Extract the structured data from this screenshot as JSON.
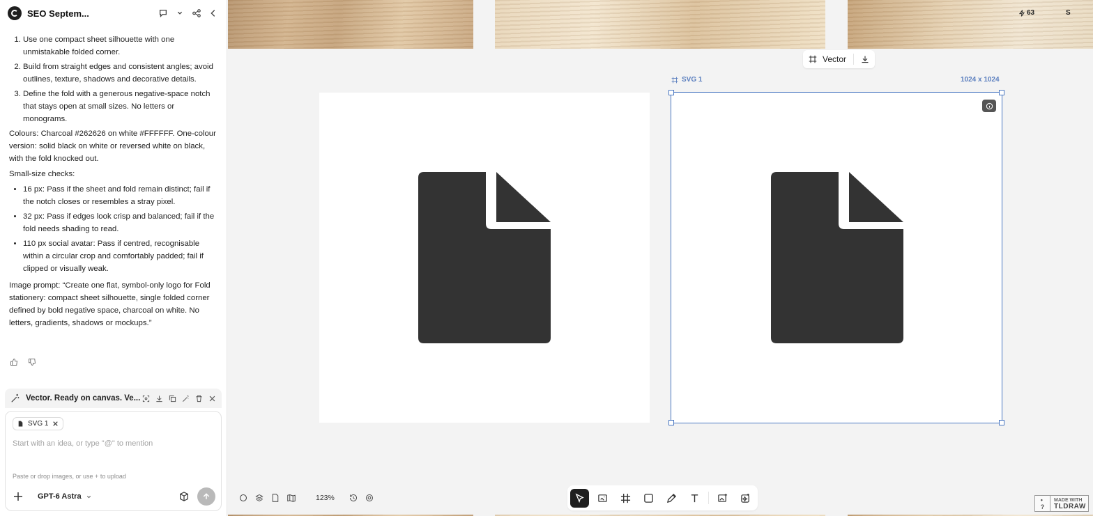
{
  "sidebar": {
    "title": "SEO Septem...",
    "message": {
      "steps": [
        "Use one compact sheet silhouette with one unmistakable folded corner.",
        "Build from straight edges and consistent angles; avoid outlines, texture, shadows and decorative details.",
        "Define the fold with a generous negative-space notch that stays open at small sizes. No letters or monograms."
      ],
      "colours": "Colours: Charcoal #262626 on white #FFFFFF. One-colour version: solid black on white or reversed white on black, with the fold knocked out.",
      "checks_heading": "Small-size checks:",
      "checks": [
        "16 px: Pass if the sheet and fold remain distinct; fail if the notch closes or resembles a stray pixel.",
        "32 px: Pass if edges look crisp and balanced; fail if the fold needs shading to read.",
        "110 px social avatar: Pass if centred, recognisable within a circular crop and comfortably padded; fail if clipped or visually weak."
      ],
      "image_prompt": "Image prompt: “Create one flat, symbol-only logo for Fold stationery: compact sheet silhouette, single folded corner defined by bold negative space, charcoal on white. No letters, gradients, shadows or mockups.”"
    },
    "status": "Vector. Ready on canvas. Ve...",
    "composer": {
      "chip": "SVG 1",
      "placeholder": "Start with an idea, or type \"@\" to mention",
      "hint": "Paste or drop images, or use + to upload",
      "model": "GPT-6 Astra"
    }
  },
  "canvas": {
    "credits": "63",
    "user_initial": "S",
    "frame_toolbar_label": "Vector",
    "frame_name": "SVG 1",
    "frame_size": "1024 x 1024",
    "zoom": "123%",
    "glyph_color": "#333333",
    "badge_line1": "MADE WITH",
    "badge_line2": "TLDRAW"
  }
}
